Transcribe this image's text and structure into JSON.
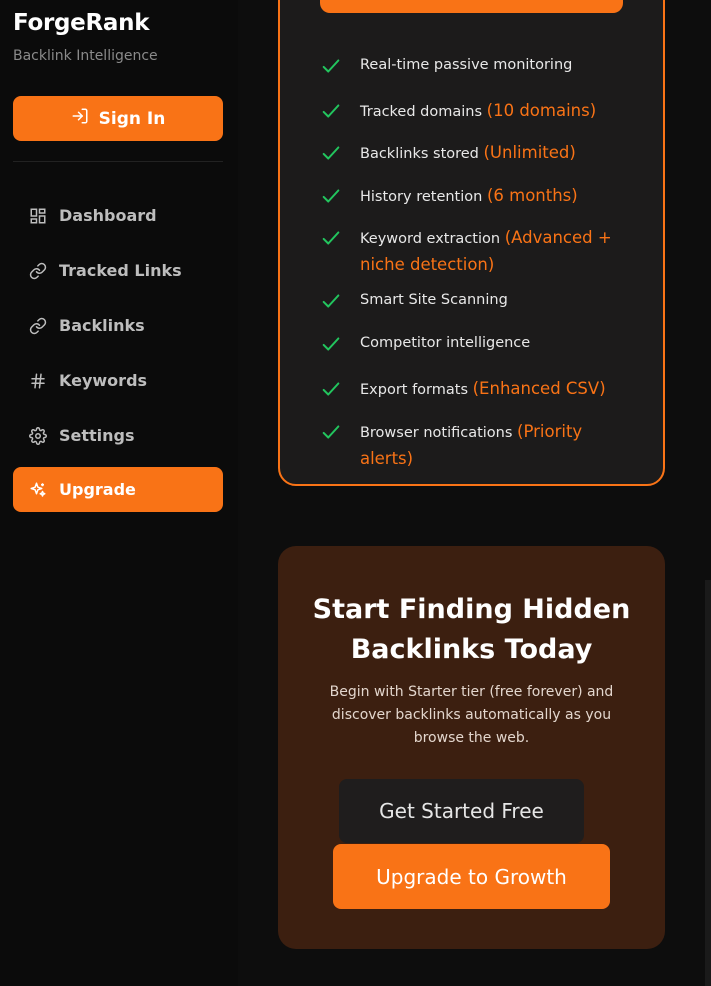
{
  "sidebar": {
    "brand": "ForgeRank",
    "tagline": "Backlink Intelligence",
    "sign_in_label": "Sign In",
    "nav": [
      {
        "label": "Dashboard",
        "icon": "grid-icon"
      },
      {
        "label": "Tracked Links",
        "icon": "link-icon"
      },
      {
        "label": "Backlinks",
        "icon": "link-icon"
      },
      {
        "label": "Keywords",
        "icon": "hash-icon"
      },
      {
        "label": "Settings",
        "icon": "gear-icon"
      },
      {
        "label": "Upgrade",
        "icon": "sparkles-icon",
        "active": true
      }
    ]
  },
  "plan": {
    "features": [
      {
        "text": "Real-time passive monitoring",
        "accent": ""
      },
      {
        "text": "Tracked domains",
        "accent": "(10 domains)"
      },
      {
        "text": "Backlinks stored",
        "accent": "(Unlimited)"
      },
      {
        "text": "History retention",
        "accent": "(6 months)"
      },
      {
        "text": "Keyword extraction",
        "accent": "(Advanced +",
        "accent2": "niche detection)"
      },
      {
        "text": "Smart Site Scanning",
        "accent": ""
      },
      {
        "text": "Competitor intelligence",
        "accent": ""
      },
      {
        "text": "Export formats",
        "accent": "(Enhanced CSV)"
      },
      {
        "text": "Browser notifications",
        "accent": "(Priority alerts)"
      }
    ]
  },
  "cta": {
    "title_line1": "Start Finding Hidden",
    "title_line2": "Backlinks Today",
    "description": "Begin with Starter tier (free forever) and discover backlinks automatically as you browse the web.",
    "free_button": "Get Started Free",
    "growth_button": "Upgrade to Growth"
  },
  "colors": {
    "accent": "#f97316",
    "check": "#22c55e",
    "cta_background": "#3c1f10"
  }
}
